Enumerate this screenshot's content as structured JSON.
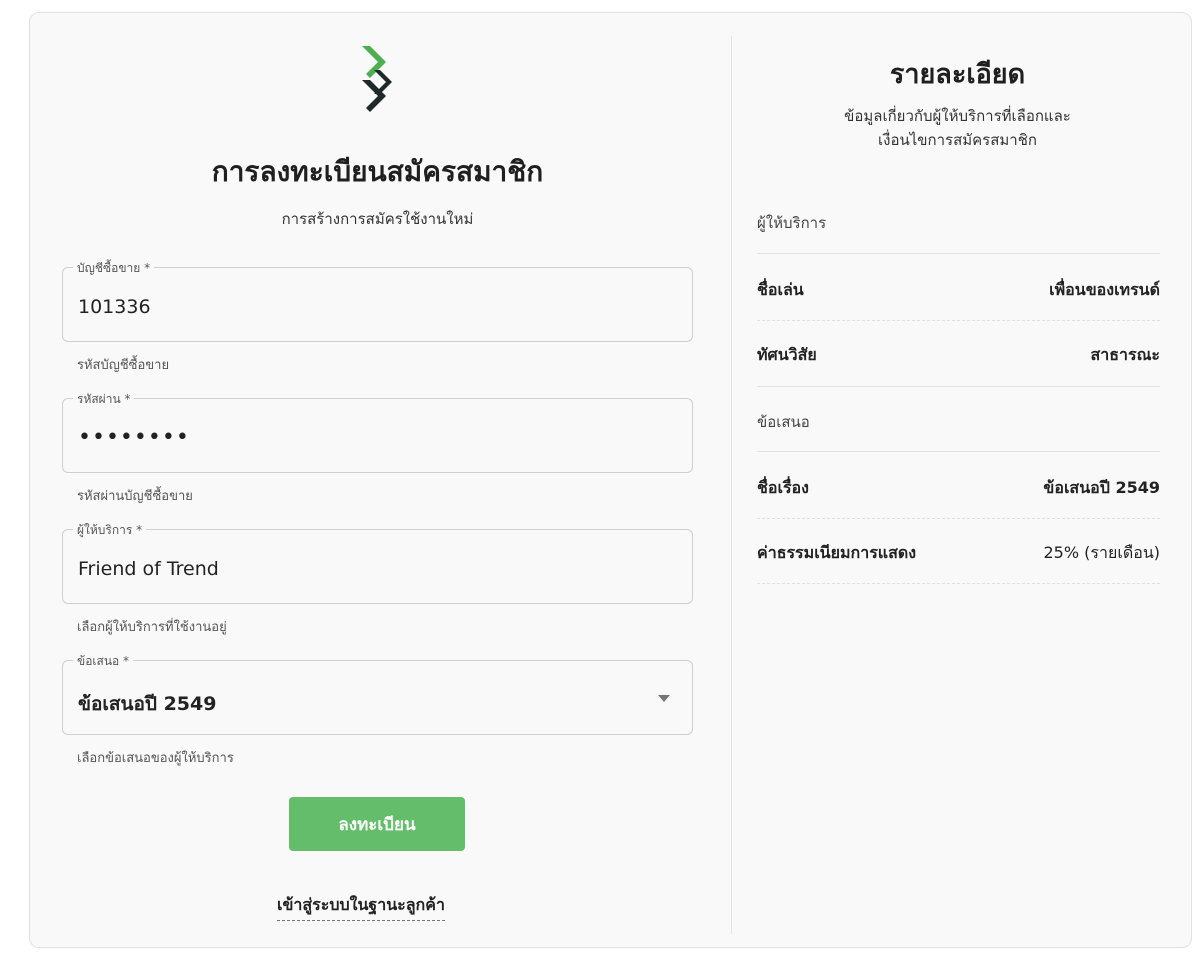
{
  "form": {
    "title": "การลงทะเบียนสมัครสมาชิก",
    "subtitle": "การสร้างการสมัครใช้งานใหม่",
    "fields": [
      {
        "label": "บัญชีซื้อขาย *",
        "value": "101336",
        "helper": "รหัสบัญชีซื้อขาย"
      },
      {
        "label": "รหัสผ่าน *",
        "value": "••••••••",
        "helper": "รหัสผ่านบัญชีซื้อขาย"
      },
      {
        "label": "ผู้ให้บริการ *",
        "value": "Friend of Trend",
        "helper": "เลือกผู้ให้บริการที่ใช้งานอยู่"
      },
      {
        "label": "ข้อเสนอ *",
        "value": "ข้อเสนอปี 2549",
        "helper": "เลือกข้อเสนอของผู้ให้บริการ"
      }
    ],
    "submit_label": "ลงทะเบียน",
    "login_link": "เข้าสู่ระบบในฐานะลูกค้า"
  },
  "details": {
    "title": "รายละเอียด",
    "description_line1": "ข้อมูลเกี่ยวกับผู้ให้บริการที่เลือกและ",
    "description_line2": "เงื่อนไขการสมัครสมาชิก",
    "provider_section": "ผู้ให้บริการ",
    "nickname_label": "ชื่อเล่น",
    "nickname_value": "เพื่อนของเทรนด์",
    "visibility_label": "ทัศนวิสัย",
    "visibility_value": "สาธารณะ",
    "offer_section": "ข้อเสนอ",
    "offer_name_label": "ชื่อเรื่อง",
    "offer_name_value": "ข้อเสนอปี 2549",
    "fee_label": "ค่าธรรมเนียมการแสดง",
    "fee_value": "25% (รายเดือน)"
  },
  "colors": {
    "accent_green": "#64bd6a",
    "logo_green": "#4caf50",
    "logo_dark": "#1e2a2a"
  }
}
